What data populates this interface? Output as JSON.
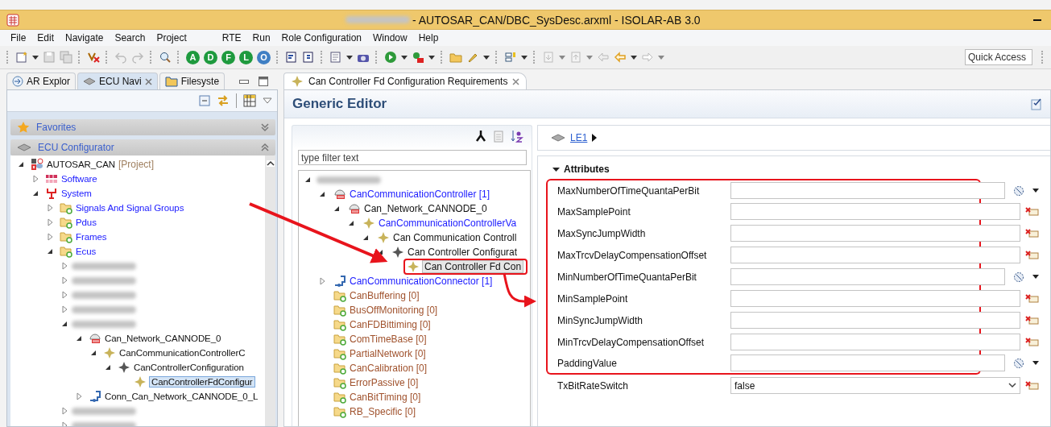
{
  "window": {
    "title": "- AUTOSAR_CAN/DBC_SysDesc.arxml - ISOLAR-AB 3.0"
  },
  "menu": [
    "File",
    "Edit",
    "Navigate",
    "Search",
    "Project",
    "RTE",
    "Run",
    "Role Configuration",
    "Window",
    "Help"
  ],
  "toolbar": {
    "letter_buttons": [
      {
        "label": "A",
        "color": "#1e9a3e"
      },
      {
        "label": "D",
        "color": "#1e9a3e"
      },
      {
        "label": "F",
        "color": "#1e9a3e"
      },
      {
        "label": "L",
        "color": "#1e9a3e"
      },
      {
        "label": "O",
        "color": "#3f7fc4"
      }
    ],
    "quick_access": {
      "placeholder": "Quick Access"
    }
  },
  "left_panel": {
    "tabs": [
      {
        "label": "AR Explor",
        "selected": false
      },
      {
        "label": "ECU Navi",
        "selected": true
      },
      {
        "label": "Filesyste",
        "selected": false
      }
    ],
    "sections": [
      {
        "title": "Favorites",
        "expanded": false
      },
      {
        "title": "ECU Configurator",
        "expanded": true
      }
    ],
    "tree": [
      {
        "label": "AUTOSAR_CAN",
        "suffix": "[Project]",
        "kind": "project",
        "expanded": true,
        "children": [
          {
            "label": "Software",
            "kind": "software",
            "expanded": false
          },
          {
            "label": "System",
            "kind": "system",
            "expanded": true,
            "children": [
              {
                "label": "Signals And Signal Groups",
                "kind": "group",
                "expanded": false
              },
              {
                "label": "Pdus",
                "kind": "group",
                "expanded": false
              },
              {
                "label": "Frames",
                "kind": "group",
                "expanded": false
              },
              {
                "label": "Ecus",
                "kind": "group",
                "expanded": true,
                "children": [
                  {
                    "kind": "redacted",
                    "expanded": false
                  },
                  {
                    "kind": "redacted",
                    "expanded": false
                  },
                  {
                    "kind": "redacted",
                    "expanded": false
                  },
                  {
                    "kind": "redacted",
                    "expanded": false
                  },
                  {
                    "kind": "redacted",
                    "expanded": true,
                    "children": [
                      {
                        "label": "Can_Network_CANNODE_0",
                        "kind": "controller",
                        "expanded": true,
                        "children": [
                          {
                            "label": "CanCommunicationControllerC",
                            "kind": "container",
                            "expanded": true,
                            "children": [
                              {
                                "label": "CanControllerConfiguration",
                                "kind": "configuration",
                                "expanded": true,
                                "children": [
                                  {
                                    "label": "CanControllerFdConfigur",
                                    "kind": "container",
                                    "selected": true
                                  }
                                ]
                              }
                            ]
                          }
                        ]
                      },
                      {
                        "label": "Conn_Can_Network_CANNODE_0_L",
                        "kind": "connector",
                        "expanded": false
                      }
                    ]
                  },
                  {
                    "kind": "redacted",
                    "expanded": false
                  },
                  {
                    "kind": "redacted",
                    "expanded": false
                  }
                ]
              }
            ]
          }
        ]
      }
    ]
  },
  "editor": {
    "tab": "Can Controller Fd Configuration Requirements",
    "title": "Generic Editor",
    "filter": {
      "placeholder": "type filter text"
    },
    "tree": [
      {
        "kind": "redacted",
        "expanded": true,
        "children": [
          {
            "label": "CanCommunicationController [1]",
            "kind": "controllers",
            "expanded": true,
            "children": [
              {
                "label": "Can_Network_CANNODE_0",
                "kind": "controller",
                "expanded": true,
                "children": [
                  {
                    "label": "CanCommunicationControllerVa",
                    "kind": "definition",
                    "expanded": true,
                    "children": [
                      {
                        "label": "Can Communication Controll",
                        "kind": "container",
                        "expanded": true,
                        "children": [
                          {
                            "label": "Can Controller Configurat",
                            "kind": "configuration",
                            "expanded": true,
                            "children": [
                              {
                                "label": "Can Controller Fd Con",
                                "kind": "container",
                                "selected": true,
                                "highlighted": true
                              }
                            ]
                          }
                        ]
                      }
                    ]
                  }
                ]
              }
            ]
          },
          {
            "label": "CanCommunicationConnector [1]",
            "kind": "connectors",
            "expanded": false
          },
          {
            "label": "CanBuffering [0]",
            "kind": "empty"
          },
          {
            "label": "BusOffMonitoring [0]",
            "kind": "empty"
          },
          {
            "label": "CanFDBittiming [0]",
            "kind": "empty"
          },
          {
            "label": "ComTimeBase [0]",
            "kind": "empty"
          },
          {
            "label": "PartialNetwork [0]",
            "kind": "empty"
          },
          {
            "label": "CanCalibration [0]",
            "kind": "empty"
          },
          {
            "label": "ErrorPassive [0]",
            "kind": "empty"
          },
          {
            "label": "CanBitTiming [0]",
            "kind": "empty"
          },
          {
            "label": "RB_Specific [0]",
            "kind": "empty"
          }
        ]
      }
    ],
    "breadcrumb": "LE1",
    "attributes": {
      "title": "Attributes",
      "expanded": true,
      "rows": [
        {
          "label": "MaxNumberOfTimeQuantaPerBit",
          "kind": "choice",
          "value": "",
          "highlighted": true
        },
        {
          "label": "MaxSamplePoint",
          "kind": "value",
          "value": "",
          "highlighted": true
        },
        {
          "label": "MaxSyncJumpWidth",
          "kind": "value",
          "value": "",
          "highlighted": true
        },
        {
          "label": "MaxTrcvDelayCompensationOffset",
          "kind": "value",
          "value": "",
          "highlighted": true
        },
        {
          "label": "MinNumberOfTimeQuantaPerBit",
          "kind": "choice",
          "value": "",
          "highlighted": true
        },
        {
          "label": "MinSamplePoint",
          "kind": "value",
          "value": "",
          "highlighted": true
        },
        {
          "label": "MinSyncJumpWidth",
          "kind": "value",
          "value": "",
          "highlighted": true
        },
        {
          "label": "MinTrcvDelayCompensationOffset",
          "kind": "value",
          "value": "",
          "highlighted": true
        },
        {
          "label": "PaddingValue",
          "kind": "choice",
          "value": "",
          "highlighted": true
        },
        {
          "label": "TxBitRateSwitch",
          "kind": "combo",
          "value": "false",
          "highlighted": false
        }
      ]
    }
  }
}
